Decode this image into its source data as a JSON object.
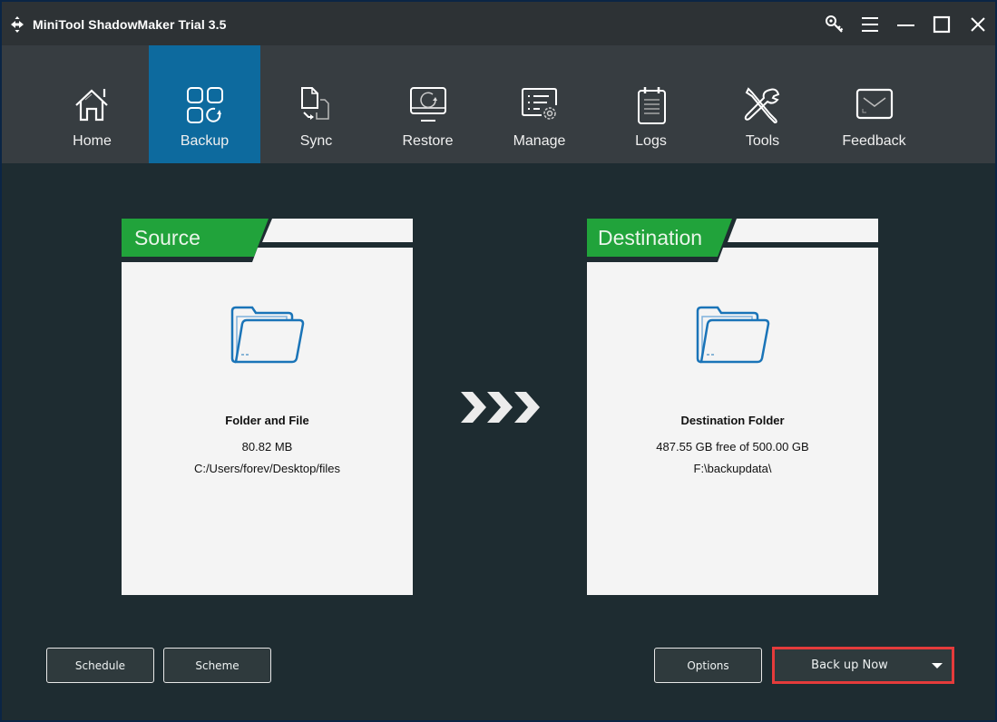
{
  "window": {
    "title": "MiniTool ShadowMaker Trial 3.5",
    "controls": [
      {
        "name": "register-key-icon",
        "label": "Register"
      },
      {
        "name": "menu-icon",
        "label": "Menu"
      },
      {
        "name": "minimize-icon",
        "label": "Minimize"
      },
      {
        "name": "maximize-icon",
        "label": "Maximize"
      },
      {
        "name": "close-icon",
        "label": "Close"
      }
    ]
  },
  "nav": {
    "active": "Backup",
    "items": [
      {
        "label": "Home",
        "icon": "home-icon"
      },
      {
        "label": "Backup",
        "icon": "backup-icon"
      },
      {
        "label": "Sync",
        "icon": "sync-icon"
      },
      {
        "label": "Restore",
        "icon": "restore-icon"
      },
      {
        "label": "Manage",
        "icon": "manage-icon"
      },
      {
        "label": "Logs",
        "icon": "logs-icon"
      },
      {
        "label": "Tools",
        "icon": "tools-icon"
      },
      {
        "label": "Feedback",
        "icon": "feedback-icon"
      }
    ]
  },
  "source": {
    "header": "Source",
    "title": "Folder and File",
    "size": "80.82 MB",
    "path": "C:/Users/forev/Desktop/files"
  },
  "destination": {
    "header": "Destination",
    "title": "Destination Folder",
    "space": "487.55 GB free of 500.00 GB",
    "path": "F:\\backupdata\\"
  },
  "buttons": {
    "schedule": "Schedule",
    "scheme": "Scheme",
    "options": "Options",
    "backup_now": "Back up Now"
  },
  "colors": {
    "accent_blue": "#0d6a9e",
    "tab_green": "#21a33b",
    "highlight_red": "#e53b3b",
    "background": "#1e2c31"
  }
}
